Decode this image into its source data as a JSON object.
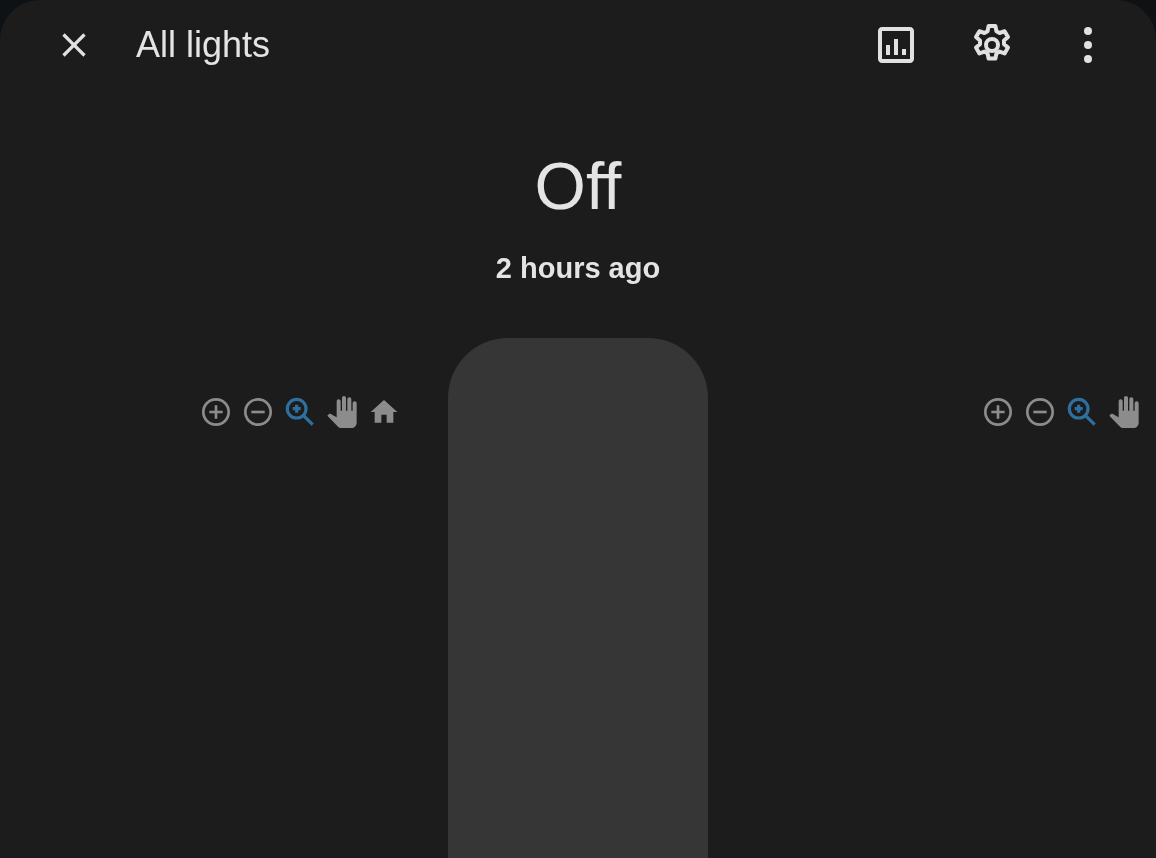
{
  "dialog": {
    "title": "All lights"
  },
  "header_actions": [
    {
      "kind": "history"
    },
    {
      "kind": "settings"
    },
    {
      "kind": "more"
    }
  ],
  "state": {
    "value": "Off",
    "changed": "2 hours ago"
  },
  "brightness_slider": {
    "level": 0
  },
  "chart_toolbars": [
    {
      "tools": [
        {
          "kind": "zoom-in",
          "selected": false
        },
        {
          "kind": "zoom-out",
          "selected": false
        },
        {
          "kind": "zoom",
          "selected": true
        },
        {
          "kind": "pan",
          "selected": false
        },
        {
          "kind": "reset",
          "selected": false
        }
      ]
    },
    {
      "tools": [
        {
          "kind": "zoom-in",
          "selected": false
        },
        {
          "kind": "zoom-out",
          "selected": false
        },
        {
          "kind": "zoom",
          "selected": true
        },
        {
          "kind": "pan",
          "selected": false
        }
      ]
    }
  ]
}
